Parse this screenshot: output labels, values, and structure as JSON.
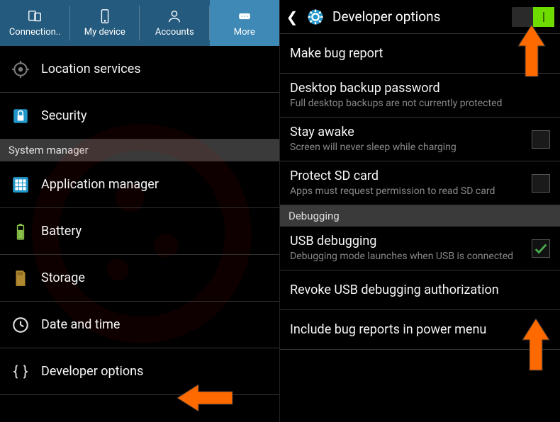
{
  "left": {
    "tabs": [
      {
        "label": "Connection.."
      },
      {
        "label": "My device"
      },
      {
        "label": "Accounts"
      },
      {
        "label": "More"
      }
    ],
    "items": {
      "location": "Location services",
      "security": "Security",
      "section": "System manager",
      "appmgr": "Application manager",
      "battery": "Battery",
      "storage": "Storage",
      "datetime": "Date and time",
      "devopts": "Developer options"
    }
  },
  "right": {
    "title": "Developer options",
    "items": {
      "bugreport": "Make bug report",
      "backup_t": "Desktop backup password",
      "backup_s": "Full desktop backups are not currently protected",
      "stay_t": "Stay awake",
      "stay_s": "Screen will never sleep while charging",
      "sd_t": "Protect SD card",
      "sd_s": "Apps must request permission to read SD card",
      "debug_hdr": "Debugging",
      "usb_t": "USB debugging",
      "usb_s": "Debugging mode launches when USB is connected",
      "revoke": "Revoke USB debugging authorization",
      "bugmenu": "Include bug reports in power menu"
    }
  }
}
